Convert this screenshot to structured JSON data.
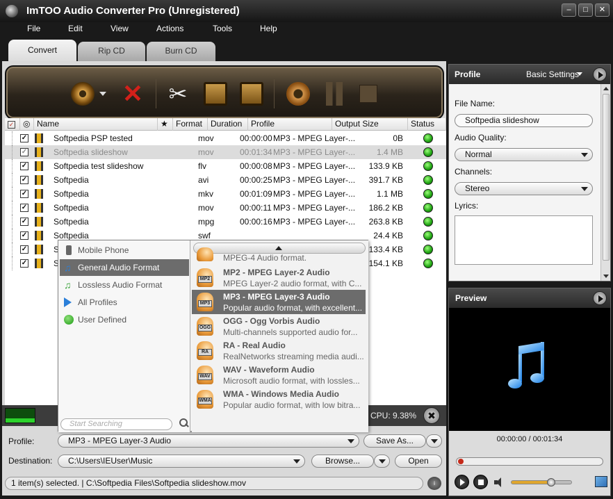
{
  "window": {
    "title": "ImTOO Audio Converter Pro (Unregistered)",
    "min": "–",
    "max": "□",
    "close": "✕"
  },
  "menu": [
    "File",
    "Edit",
    "View",
    "Actions",
    "Tools",
    "Help"
  ],
  "tabs": [
    "Convert",
    "Rip CD",
    "Burn CD"
  ],
  "columns": {
    "name": "Name",
    "format": "Format",
    "duration": "Duration",
    "profile": "Profile",
    "size": "Output Size",
    "status": "Status"
  },
  "files": [
    {
      "name": "Softpedia PSP tested",
      "format": "mov",
      "duration": "00:00:00",
      "profile": "MP3 - MPEG Layer-...",
      "size": "0B"
    },
    {
      "name": "Softpedia slideshow",
      "format": "mov",
      "duration": "00:01:34",
      "profile": "MP3 - MPEG Layer-...",
      "size": "1.4 MB"
    },
    {
      "name": "Softpedia test slideshow",
      "format": "flv",
      "duration": "00:00:08",
      "profile": "MP3 - MPEG Layer-...",
      "size": "133.9 KB"
    },
    {
      "name": "Softpedia",
      "format": "avi",
      "duration": "00:00:25",
      "profile": "MP3 - MPEG Layer-...",
      "size": "391.7 KB"
    },
    {
      "name": "Softpedia",
      "format": "mkv",
      "duration": "00:01:09",
      "profile": "MP3 - MPEG Layer-...",
      "size": "1.1 MB"
    },
    {
      "name": "Softpedia",
      "format": "mov",
      "duration": "00:00:11",
      "profile": "MP3 - MPEG Layer-...",
      "size": "186.2 KB"
    },
    {
      "name": "Softpedia",
      "format": "mpg",
      "duration": "00:00:16",
      "profile": "MP3 - MPEG Layer-...",
      "size": "263.8 KB"
    },
    {
      "name": "Softpedia",
      "format": "swf",
      "duration": "",
      "profile": "",
      "size": "24.4 KB"
    },
    {
      "name": "S",
      "format": "",
      "duration": "",
      "profile": "",
      "size": "133.4 KB"
    },
    {
      "name": "S",
      "format": "",
      "duration": "",
      "profile": "",
      "size": "154.1 KB"
    }
  ],
  "categories": [
    "Mobile Phone",
    "General Audio Format",
    "Lossless Audio Format",
    "All Profiles",
    "User Defined"
  ],
  "search_placeholder": "Start Searching",
  "profiles": [
    {
      "name": "",
      "badge": "",
      "desc": "MPEG-4 Audio format."
    },
    {
      "name": "MP2 - MPEG Layer-2 Audio",
      "badge": "MP2",
      "desc": "MPEG Layer-2 audio format, with C..."
    },
    {
      "name": "MP3 - MPEG Layer-3 Audio",
      "badge": "MP3",
      "desc": "Popular audio format, with excellent..."
    },
    {
      "name": "OGG - Ogg Vorbis Audio",
      "badge": "OGG",
      "desc": "Multi-channels supported audio for..."
    },
    {
      "name": "RA - Real Audio",
      "badge": "RA",
      "desc": "RealNetworks streaming media audi..."
    },
    {
      "name": "WAV - Waveform Audio",
      "badge": "WAV",
      "desc": "Microsoft audio format, with lossles..."
    },
    {
      "name": "WMA - Windows Media Audio",
      "badge": "WMA",
      "desc": "Popular audio format, with low bitra..."
    }
  ],
  "cpu": "CPU: 9.38%",
  "bottom": {
    "profile_label": "Profile:",
    "profile_value": "MP3 - MPEG Layer-3 Audio",
    "save_as": "Save As...",
    "destination_label": "Destination:",
    "destination_value": "C:\\Users\\IEUser\\Music",
    "browse": "Browse...",
    "open": "Open"
  },
  "status_text": "1 item(s) selected. | C:\\Softpedia Files\\Softpedia slideshow.mov",
  "profile_panel": {
    "title": "Profile",
    "basic_settings": "Basic Settings",
    "file_name_label": "File Name:",
    "file_name": "Softpedia slideshow",
    "quality_label": "Audio Quality:",
    "quality": "Normal",
    "channels_label": "Channels:",
    "channels": "Stereo",
    "lyrics_label": "Lyrics:"
  },
  "preview": {
    "title": "Preview",
    "time": "00:00:00 / 00:01:34",
    "volume": 0.62
  }
}
